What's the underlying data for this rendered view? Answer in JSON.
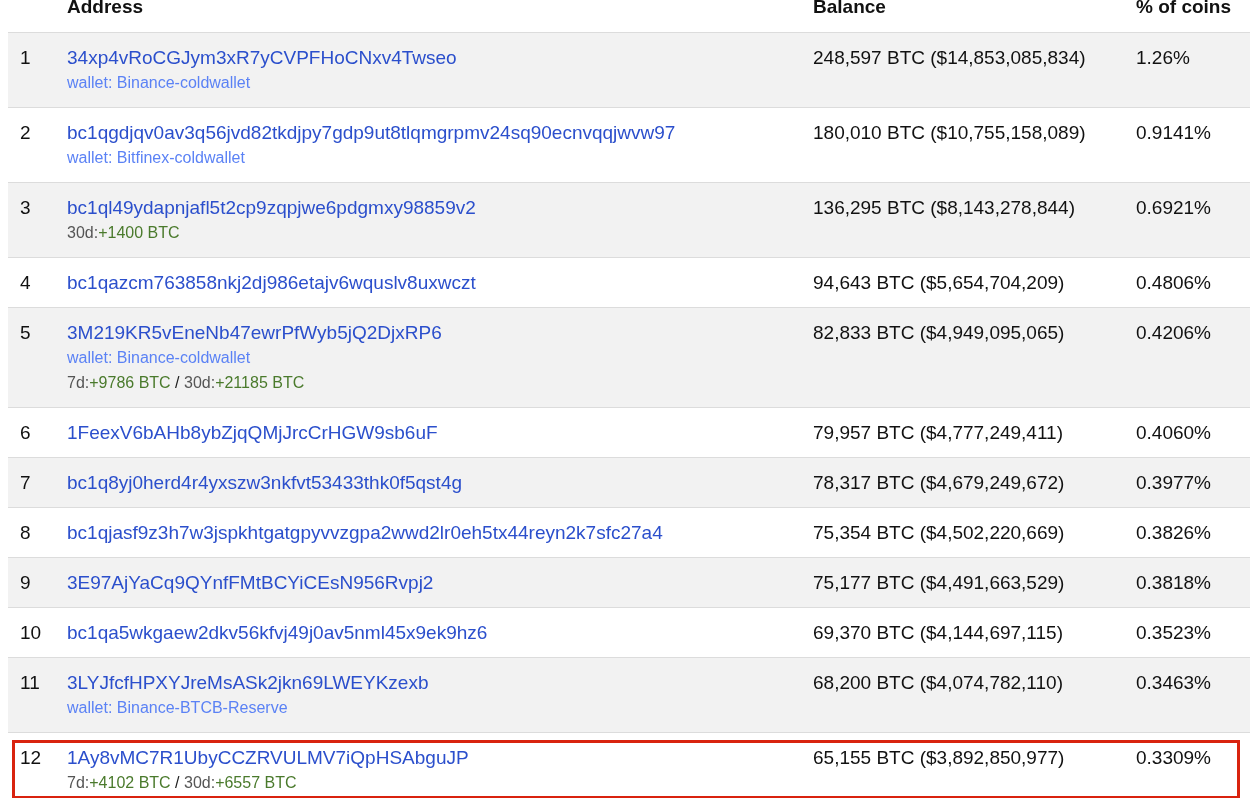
{
  "table": {
    "columns": [
      {
        "label": "Address"
      },
      {
        "label": "Balance"
      },
      {
        "label": "% of coins"
      }
    ],
    "rows": [
      {
        "rank": "1",
        "address": "34xp4vRoCGJym3xR7yCVPFHoCNxv4Twseo",
        "wallet": "wallet: Binance-coldwallet",
        "balance": "248,597 BTC ($14,853,085,834)",
        "percent": "1.26%",
        "highlighted": false
      },
      {
        "rank": "2",
        "address": "bc1qgdjqv0av3q56jvd82tkdjpy7gdp9ut8tlqmgrpmv24sq90ecnvqqjwvw97",
        "wallet": "wallet: Bitfinex-coldwallet",
        "balance": "180,010 BTC ($10,755,158,089)",
        "percent": "0.9141%",
        "highlighted": false
      },
      {
        "rank": "3",
        "address": "bc1ql49ydapnjafl5t2cp9zqpjwe6pdgmxy98859v2",
        "changes": [
          {
            "period": "30d:",
            "amount": "+1400 BTC"
          }
        ],
        "balance": "136,295 BTC ($8,143,278,844)",
        "percent": "0.6921%",
        "highlighted": false
      },
      {
        "rank": "4",
        "address": "bc1qazcm763858nkj2dj986etajv6wquslv8uxwczt",
        "balance": "94,643 BTC ($5,654,704,209)",
        "percent": "0.4806%",
        "highlighted": false
      },
      {
        "rank": "5",
        "address": "3M219KR5vEneNb47ewrPfWyb5jQ2DjxRP6",
        "wallet": "wallet: Binance-coldwallet",
        "changes": [
          {
            "period": "7d:",
            "amount": "+9786 BTC"
          },
          {
            "separator": "/",
            "period": "30d:",
            "amount": "+21185 BTC"
          }
        ],
        "balance": "82,833 BTC ($4,949,095,065)",
        "percent": "0.4206%",
        "highlighted": false
      },
      {
        "rank": "6",
        "address": "1FeexV6bAHb8ybZjqQMjJrcCrHGW9sb6uF",
        "balance": "79,957 BTC ($4,777,249,411)",
        "percent": "0.4060%",
        "highlighted": false
      },
      {
        "rank": "7",
        "address": "bc1q8yj0herd4r4yxszw3nkfvt53433thk0f5qst4g",
        "balance": "78,317 BTC ($4,679,249,672)",
        "percent": "0.3977%",
        "highlighted": false
      },
      {
        "rank": "8",
        "address": "bc1qjasf9z3h7w3jspkhtgatgpyvvzgpa2wwd2lr0eh5tx44reyn2k7sfc27a4",
        "balance": "75,354 BTC ($4,502,220,669)",
        "percent": "0.3826%",
        "highlighted": false
      },
      {
        "rank": "9",
        "address": "3E97AjYaCq9QYnfFMtBCYiCEsN956Rvpj2",
        "balance": "75,177 BTC ($4,491,663,529)",
        "percent": "0.3818%",
        "highlighted": false
      },
      {
        "rank": "10",
        "address": "bc1qa5wkgaew2dkv56kfvj49j0av5nml45x9ek9hz6",
        "balance": "69,370 BTC ($4,144,697,115)",
        "percent": "0.3523%",
        "highlighted": false
      },
      {
        "rank": "11",
        "address": "3LYJfcfHPXYJreMsASk2jkn69LWEYKzexb",
        "wallet": "wallet: Binance-BTCB-Reserve",
        "balance": "68,200 BTC ($4,074,782,110)",
        "percent": "0.3463%",
        "highlighted": false
      },
      {
        "rank": "12",
        "address": "1Ay8vMC7R1UbyCCZRVULMV7iQpHSAbguJP",
        "changes": [
          {
            "period": "7d:",
            "amount": "+4102 BTC"
          },
          {
            "separator": "/",
            "period": "30d:",
            "amount": "+6557 BTC"
          }
        ],
        "balance": "65,155 BTC ($3,892,850,977)",
        "percent": "0.3309%",
        "highlighted": true
      }
    ]
  }
}
